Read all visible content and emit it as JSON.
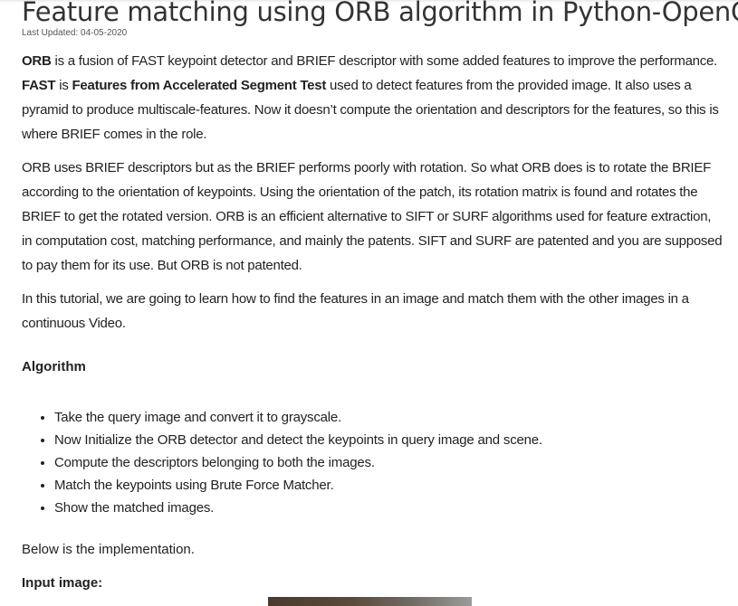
{
  "article": {
    "title": "Feature matching using ORB algorithm in Python-OpenCV",
    "last_updated": "Last Updated: 04-05-2020",
    "p1": {
      "b1": "ORB",
      "t1": " is a fusion of FAST keypoint detector and BRIEF descriptor with some added features to improve the performance. ",
      "b2": "FAST",
      "t2": " is ",
      "b3": "Features from Accelerated Segment Test",
      "t3": " used to detect features from the provided image. It also uses a pyramid to produce multiscale-features. Now it doesn’t compute the orientation and descriptors for the features, so this is where BRIEF comes in the role."
    },
    "p2": "ORB uses BRIEF descriptors but as the BRIEF performs poorly with rotation. So what ORB does is to rotate the BRIEF according to the orientation of keypoints. Using the orientation of the patch, its rotation matrix is found and rotates the BRIEF to get the rotated version. ORB is an efficient alternative to SIFT or SURF algorithms used for feature extraction, in computation cost, matching performance, and mainly the patents. SIFT and SURF are patented and you are supposed to pay them for its use. But ORB is not patented.",
    "p3": "In this tutorial, we are going to learn how to find the features in an image and match them with the other images in a continuous Video.",
    "algorithm_heading": "Algorithm",
    "steps": [
      "Take the query image and convert it to grayscale.",
      "Now Initialize the ORB detector and detect the keypoints in query image and scene.",
      "Compute the descriptors belonging to both the images.",
      "Match the keypoints using Brute Force Matcher.",
      "Show the matched images."
    ],
    "below": "Below is the implementation.",
    "input_label": "Input image:"
  }
}
